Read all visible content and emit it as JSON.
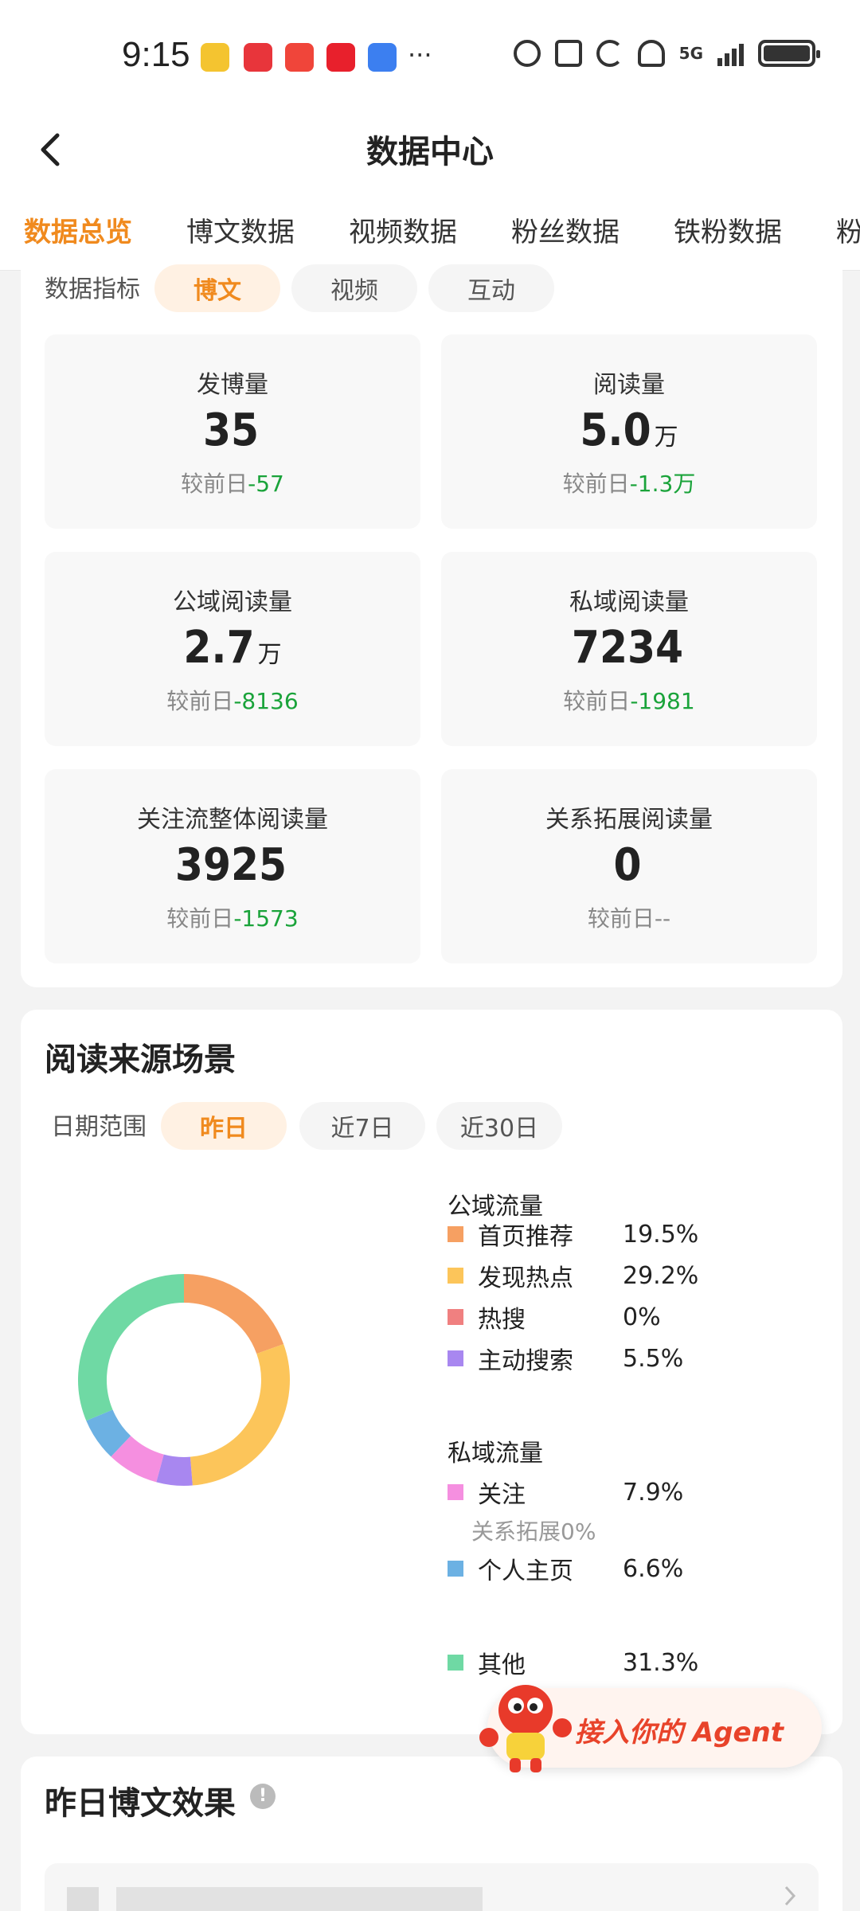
{
  "status": {
    "time": "9:15",
    "net": "5G",
    "battery_level": 1.0
  },
  "nav": {
    "title": "数据中心"
  },
  "tabs": [
    "数据总览",
    "博文数据",
    "视频数据",
    "粉丝数据",
    "铁粉数据",
    "粉"
  ],
  "indicator": {
    "label": "数据指标",
    "chips": [
      "博文",
      "视频",
      "互动"
    ],
    "active": 0
  },
  "metrics": [
    {
      "label": "发博量",
      "value": "35",
      "unit": "",
      "delta_prefix": "较前日",
      "delta": "-57"
    },
    {
      "label": "阅读量",
      "value": "5.0",
      "unit": "万",
      "delta_prefix": "较前日",
      "delta": "-1.3万"
    },
    {
      "label": "公域阅读量",
      "value": "2.7",
      "unit": "万",
      "delta_prefix": "较前日",
      "delta": "-8136"
    },
    {
      "label": "私域阅读量",
      "value": "7234",
      "unit": "",
      "delta_prefix": "较前日",
      "delta": "-1981"
    },
    {
      "label": "关注流整体阅读量",
      "value": "3925",
      "unit": "",
      "delta_prefix": "较前日",
      "delta": "-1573"
    },
    {
      "label": "关系拓展阅读量",
      "value": "0",
      "unit": "",
      "delta_prefix": "较前日",
      "delta": "--"
    }
  ],
  "source": {
    "title": "阅读来源场景",
    "date_label": "日期范围",
    "chips": [
      "昨日",
      "近7日",
      "近30日"
    ],
    "active": 0,
    "public_title": "公域流量",
    "private_title": "私域流量",
    "note": "关系拓展0%",
    "items": [
      {
        "name": "首页推荐",
        "pct": "19.5%",
        "value": 19.5,
        "color": "#f6a062"
      },
      {
        "name": "发现热点",
        "pct": "29.2%",
        "value": 29.2,
        "color": "#fcc55a"
      },
      {
        "name": "热搜",
        "pct": "0%",
        "value": 0,
        "color": "#f08080"
      },
      {
        "name": "主动搜索",
        "pct": "5.5%",
        "value": 5.5,
        "color": "#a887f0"
      },
      {
        "name": "关注",
        "pct": "7.9%",
        "value": 7.9,
        "color": "#f58fe0"
      },
      {
        "name": "个人主页",
        "pct": "6.6%",
        "value": 6.6,
        "color": "#6cb1e3"
      },
      {
        "name": "其他",
        "pct": "31.3%",
        "value": 31.3,
        "color": "#6fd9a4"
      }
    ]
  },
  "agent": {
    "label": "接入你的 Agent"
  },
  "yesterday": {
    "title": "昨日博文效果"
  }
}
